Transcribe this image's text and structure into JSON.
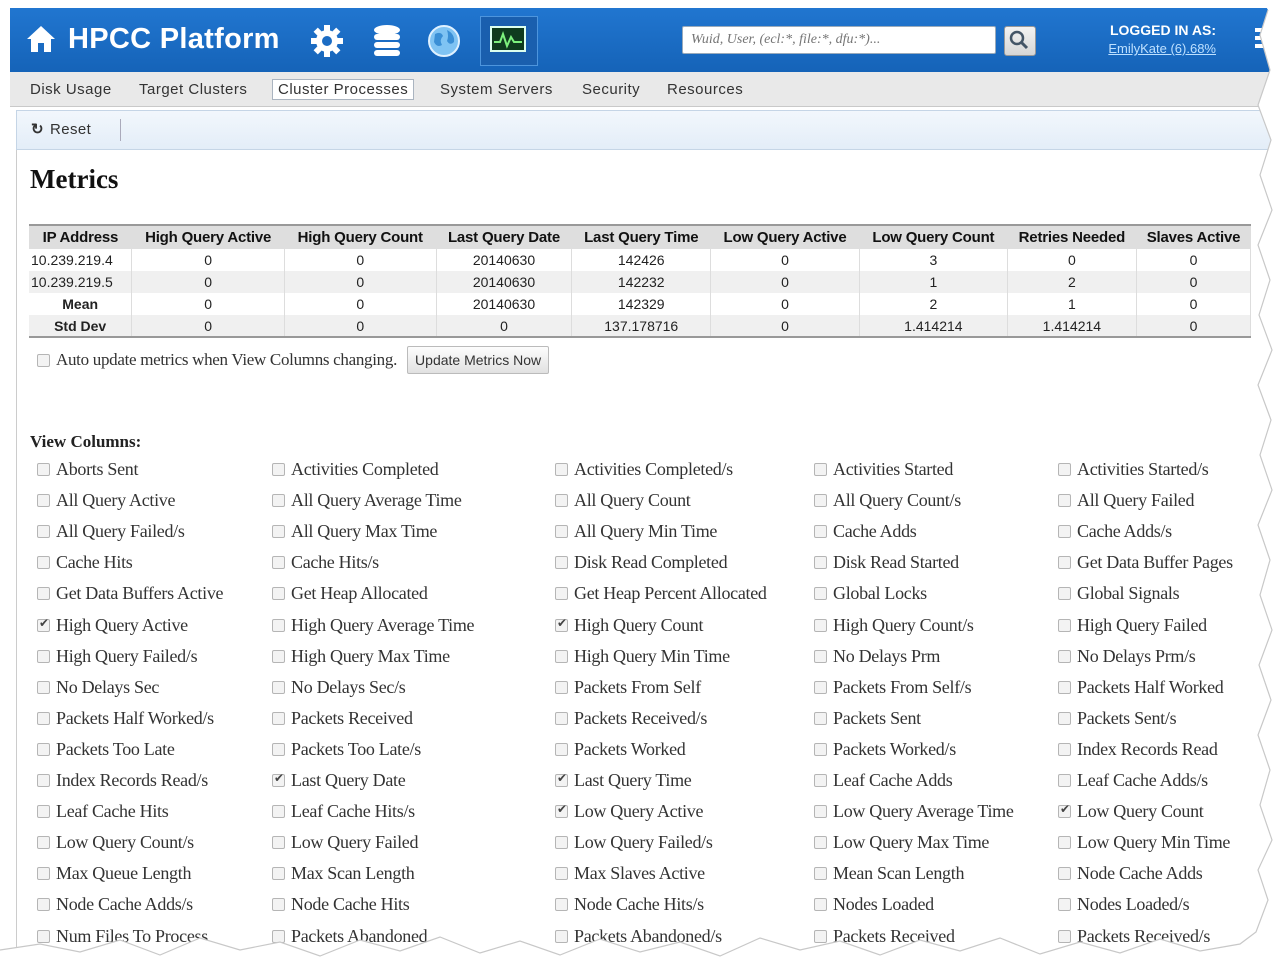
{
  "header": {
    "brand": "HPCC Platform",
    "search_placeholder": "Wuid, User, (ecl:*, file:*, dfu:*)...",
    "logged_in_label": "LOGGED IN AS:",
    "logged_in_user": "EmilyKate (6).68%",
    "icons": [
      "home-icon",
      "gear-icon",
      "database-icon",
      "globe-icon",
      "monitor-icon",
      "search-icon",
      "menu-icon"
    ]
  },
  "nav": {
    "tabs": [
      "Disk Usage",
      "Target Clusters",
      "Cluster Processes",
      "System Servers",
      "Security",
      "Resources"
    ],
    "active": "Cluster Processes"
  },
  "toolbar": {
    "reset_label": "Reset",
    "reset_icon": "refresh-icon"
  },
  "page": {
    "title": "Metrics"
  },
  "metrics_table": {
    "headers": [
      "IP Address",
      "High Query Active",
      "High Query Count",
      "Last Query Date",
      "Last Query Time",
      "Low Query Active",
      "Low Query Count",
      "Retries Needed",
      "Slaves Active"
    ],
    "rows": [
      [
        "10.239.219.4",
        "0",
        "0",
        "20140630",
        "142426",
        "0",
        "3",
        "0",
        "0"
      ],
      [
        "10.239.219.5",
        "0",
        "0",
        "20140630",
        "142232",
        "0",
        "1",
        "2",
        "0"
      ],
      [
        "Mean",
        "0",
        "0",
        "20140630",
        "142329",
        "0",
        "2",
        "1",
        "0"
      ],
      [
        "Std Dev",
        "0",
        "0",
        "0",
        "137.178716",
        "0",
        "1.414214",
        "1.414214",
        "0"
      ]
    ]
  },
  "auto_update": {
    "label": "Auto update metrics when View Columns changing.",
    "checked": false,
    "button_label": "Update Metrics Now"
  },
  "view_columns": {
    "label": "View Columns:",
    "items": [
      {
        "label": "Aborts Sent",
        "checked": false
      },
      {
        "label": "Activities Completed",
        "checked": false
      },
      {
        "label": "Activities Completed/s",
        "checked": false
      },
      {
        "label": "Activities Started",
        "checked": false
      },
      {
        "label": "Activities Started/s",
        "checked": false
      },
      {
        "label": "All Query Active",
        "checked": false
      },
      {
        "label": "All Query Average Time",
        "checked": false
      },
      {
        "label": "All Query Count",
        "checked": false
      },
      {
        "label": "All Query Count/s",
        "checked": false
      },
      {
        "label": "All Query Failed",
        "checked": false
      },
      {
        "label": "All Query Failed/s",
        "checked": false
      },
      {
        "label": "All Query Max Time",
        "checked": false
      },
      {
        "label": "All Query Min Time",
        "checked": false
      },
      {
        "label": "Cache Adds",
        "checked": false
      },
      {
        "label": "Cache Adds/s",
        "checked": false
      },
      {
        "label": "Cache Hits",
        "checked": false
      },
      {
        "label": "Cache Hits/s",
        "checked": false
      },
      {
        "label": "Disk Read Completed",
        "checked": false
      },
      {
        "label": "Disk Read Started",
        "checked": false
      },
      {
        "label": "Get Data Buffer Pages",
        "checked": false
      },
      {
        "label": "Get Data Buffers Active",
        "checked": false
      },
      {
        "label": "Get Heap Allocated",
        "checked": false
      },
      {
        "label": "Get Heap Percent Allocated",
        "checked": false
      },
      {
        "label": "Global Locks",
        "checked": false
      },
      {
        "label": "Global Signals",
        "checked": false
      },
      {
        "label": "High Query Active",
        "checked": true
      },
      {
        "label": "High Query Average Time",
        "checked": false
      },
      {
        "label": "High Query Count",
        "checked": true
      },
      {
        "label": "High Query Count/s",
        "checked": false
      },
      {
        "label": "High Query Failed",
        "checked": false
      },
      {
        "label": "High Query Failed/s",
        "checked": false
      },
      {
        "label": "High Query Max Time",
        "checked": false
      },
      {
        "label": "High Query Min Time",
        "checked": false
      },
      {
        "label": "No Delays Prm",
        "checked": false
      },
      {
        "label": "No Delays Prm/s",
        "checked": false
      },
      {
        "label": "No Delays Sec",
        "checked": false
      },
      {
        "label": "No Delays Sec/s",
        "checked": false
      },
      {
        "label": "Packets From Self",
        "checked": false
      },
      {
        "label": "Packets From Self/s",
        "checked": false
      },
      {
        "label": "Packets Half Worked",
        "checked": false
      },
      {
        "label": "Packets Half Worked/s",
        "checked": false
      },
      {
        "label": "Packets Received",
        "checked": false
      },
      {
        "label": "Packets Received/s",
        "checked": false
      },
      {
        "label": "Packets Sent",
        "checked": false
      },
      {
        "label": "Packets Sent/s",
        "checked": false
      },
      {
        "label": "Packets Too Late",
        "checked": false
      },
      {
        "label": "Packets Too Late/s",
        "checked": false
      },
      {
        "label": "Packets Worked",
        "checked": false
      },
      {
        "label": "Packets Worked/s",
        "checked": false
      },
      {
        "label": "Index Records Read",
        "checked": false
      },
      {
        "label": "Index Records Read/s",
        "checked": false
      },
      {
        "label": "Last Query Date",
        "checked": true
      },
      {
        "label": "Last Query Time",
        "checked": true
      },
      {
        "label": "Leaf Cache Adds",
        "checked": false
      },
      {
        "label": "Leaf Cache Adds/s",
        "checked": false
      },
      {
        "label": "Leaf Cache Hits",
        "checked": false
      },
      {
        "label": "Leaf Cache Hits/s",
        "checked": false
      },
      {
        "label": "Low Query Active",
        "checked": true
      },
      {
        "label": "Low Query Average Time",
        "checked": false
      },
      {
        "label": "Low Query Count",
        "checked": true
      },
      {
        "label": "Low Query Count/s",
        "checked": false
      },
      {
        "label": "Low Query Failed",
        "checked": false
      },
      {
        "label": "Low Query Failed/s",
        "checked": false
      },
      {
        "label": "Low Query Max Time",
        "checked": false
      },
      {
        "label": "Low Query Min Time",
        "checked": false
      },
      {
        "label": "Max Queue Length",
        "checked": false
      },
      {
        "label": "Max Scan Length",
        "checked": false
      },
      {
        "label": "Max Slaves Active",
        "checked": false
      },
      {
        "label": "Mean Scan Length",
        "checked": false
      },
      {
        "label": "Node Cache Adds",
        "checked": false
      },
      {
        "label": "Node Cache Adds/s",
        "checked": false
      },
      {
        "label": "Node Cache Hits",
        "checked": false
      },
      {
        "label": "Node Cache Hits/s",
        "checked": false
      },
      {
        "label": "Nodes Loaded",
        "checked": false
      },
      {
        "label": "Nodes Loaded/s",
        "checked": false
      },
      {
        "label": "Num Files To Process",
        "checked": false
      },
      {
        "label": "Packets Abandoned",
        "checked": false
      },
      {
        "label": "Packets Abandoned/s",
        "checked": false
      },
      {
        "label": "Packets Received",
        "checked": false
      },
      {
        "label": "Packets Received/s",
        "checked": false
      }
    ]
  },
  "colors": {
    "header_blue": "#1b6cc4",
    "nav_bg": "#e9e9e9",
    "toolbar_bg": "#e8f0f9"
  }
}
